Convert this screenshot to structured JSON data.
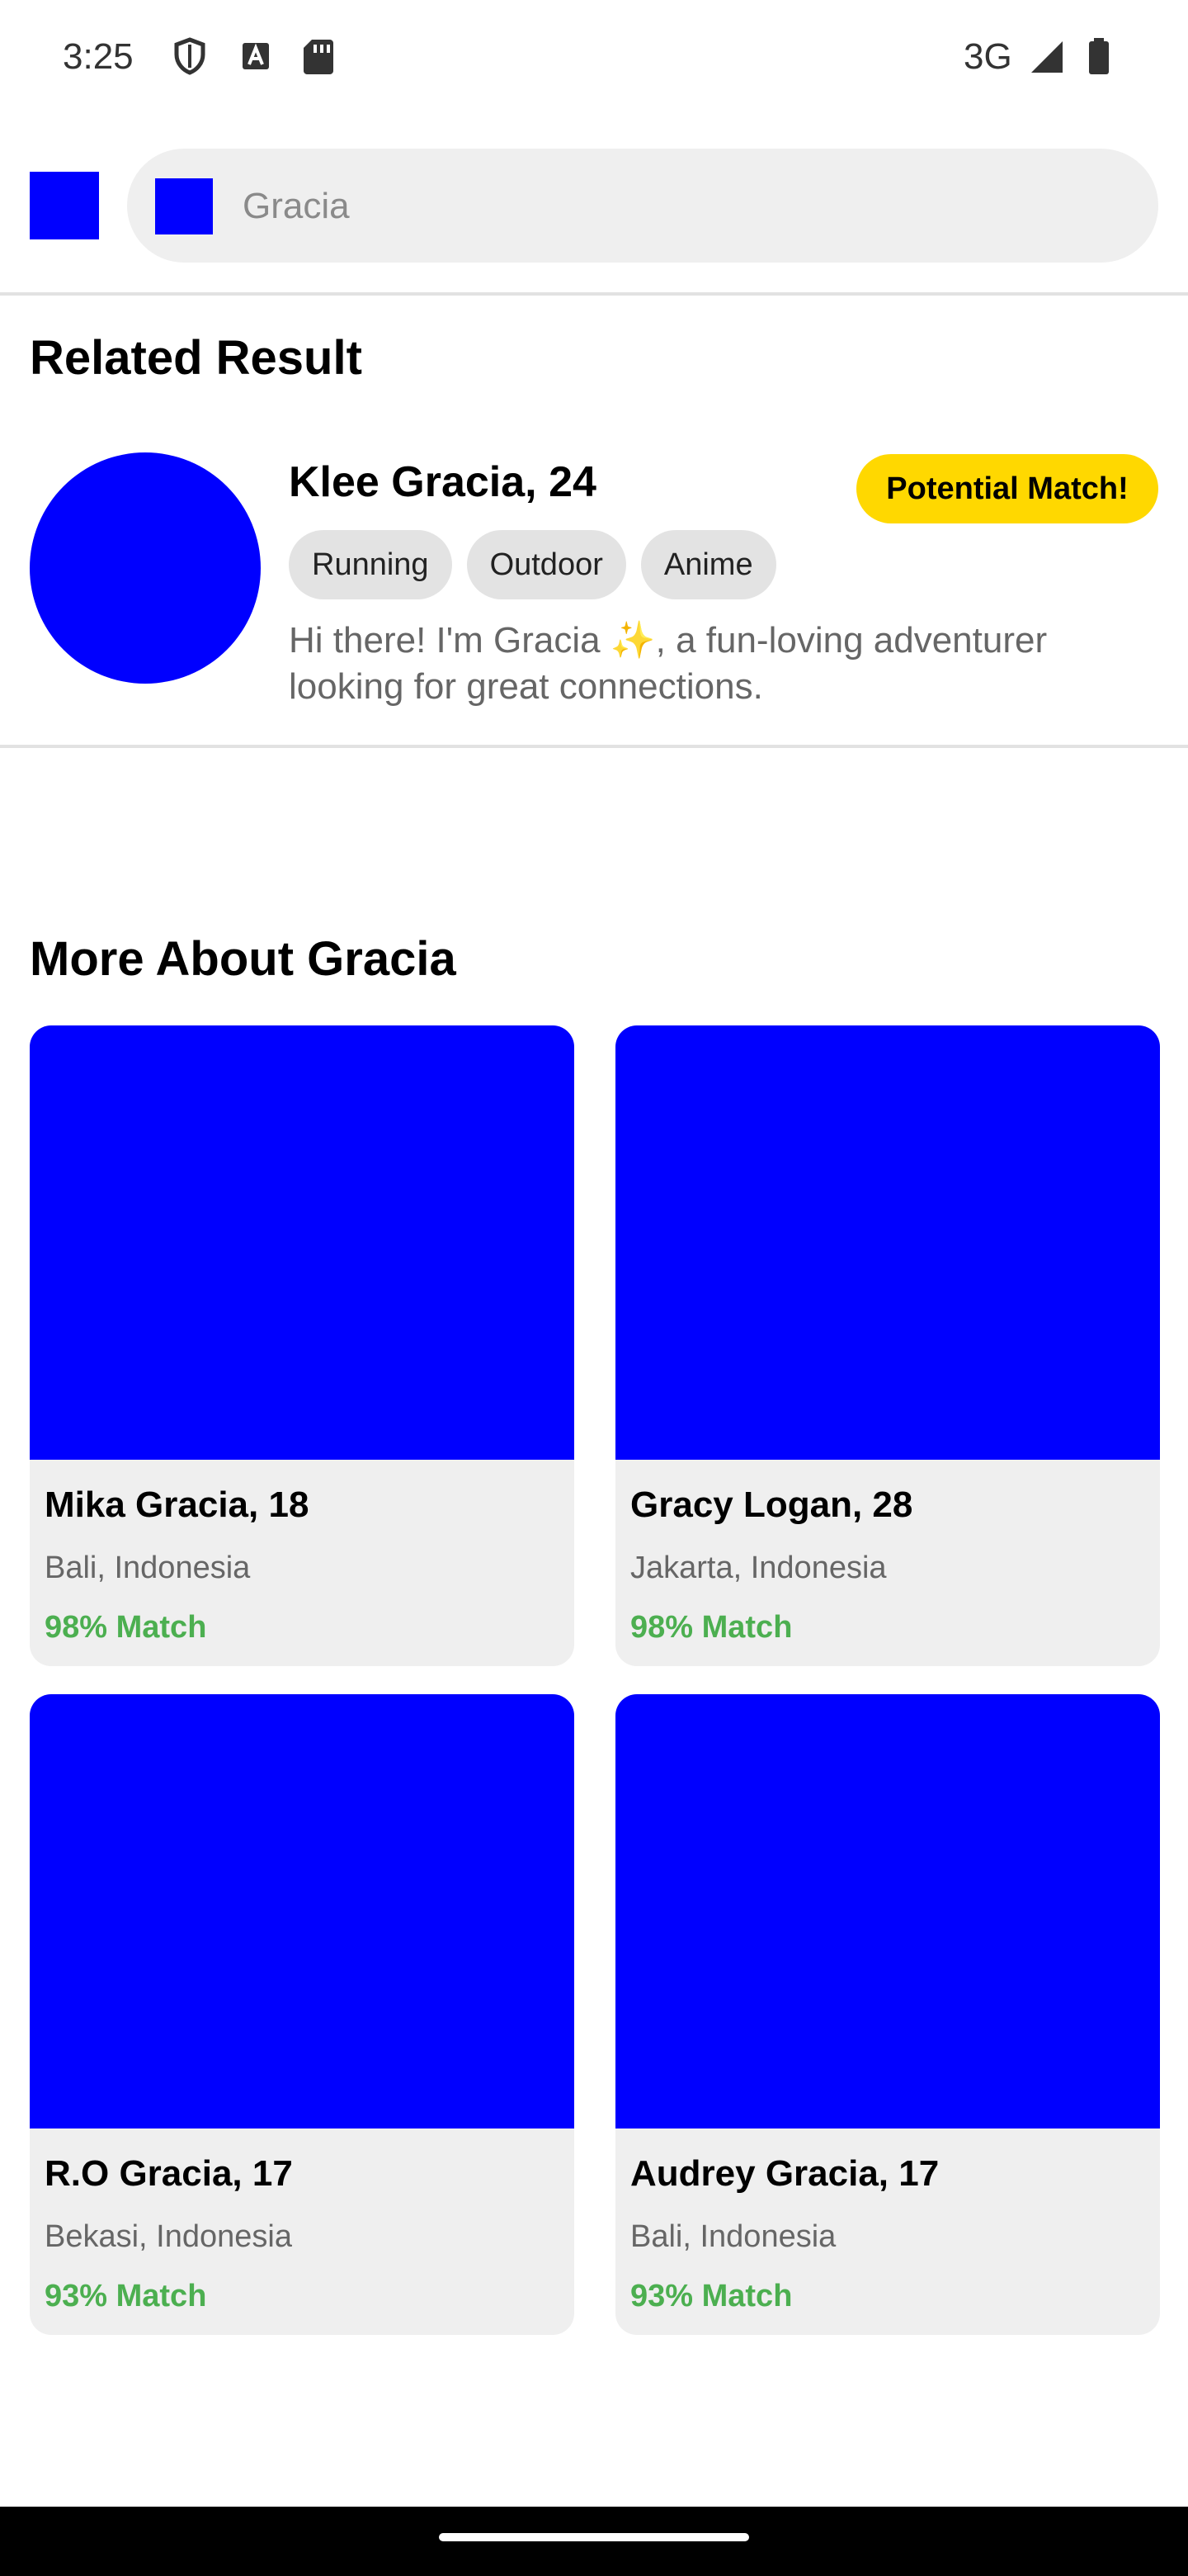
{
  "status_bar": {
    "time": "3:25",
    "network": "3G",
    "icons": [
      "shield-icon",
      "text-a-icon",
      "sd-card-icon",
      "signal-icon",
      "battery-icon"
    ]
  },
  "search": {
    "placeholder": "Gracia",
    "value": ""
  },
  "related": {
    "section_title": "Related Result",
    "name_age": "Klee Gracia, 24",
    "badge": "Potential Match!",
    "tags": [
      "Running",
      "Outdoor",
      "Anime"
    ],
    "bio": "Hi there! I'm Gracia ✨, a fun-loving adventurer looking for great connections."
  },
  "more": {
    "section_title": "More About Gracia",
    "cards": [
      {
        "name_age": "Mika Gracia, 18",
        "location": "Bali, Indonesia",
        "match": "98% Match"
      },
      {
        "name_age": "Gracy Logan, 28",
        "location": "Jakarta, Indonesia",
        "match": "98% Match"
      },
      {
        "name_age": "R.O Gracia, 17",
        "location": "Bekasi, Indonesia",
        "match": "93% Match"
      },
      {
        "name_age": "Audrey Gracia, 17",
        "location": "Bali, Indonesia",
        "match": "93% Match"
      }
    ]
  },
  "colors": {
    "placeholder_blue": "#0000ff",
    "badge_yellow": "#ffd800",
    "match_green": "#4caf50",
    "card_bg": "#efefef"
  }
}
